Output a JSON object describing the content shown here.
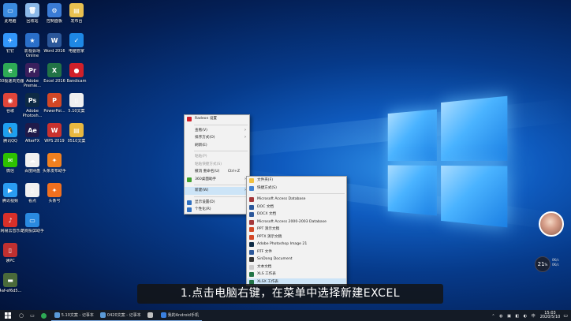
{
  "desktop_icons": [
    {
      "label": "此电脑",
      "color": "#3b8be0",
      "glyph": "▭"
    },
    {
      "label": "回收站",
      "color": "#8bb8e8",
      "glyph": "🗑"
    },
    {
      "label": "控制面板",
      "color": "#3a7bd5",
      "glyph": "⚙"
    },
    {
      "label": "发布台",
      "color": "#e8c050",
      "glyph": "▤"
    },
    {
      "label": "钉钉",
      "color": "#3296fa",
      "glyph": "✈"
    },
    {
      "label": "影视会场\nOnline",
      "color": "#2a6fc9",
      "glyph": "★"
    },
    {
      "label": "Word 2016",
      "color": "#2b579a",
      "glyph": "W"
    },
    {
      "label": "电脑管家",
      "color": "#1e88e5",
      "glyph": "✓"
    },
    {
      "label": "360极速浏览器",
      "color": "#2eaa55",
      "glyph": "e"
    },
    {
      "label": "Adobe\nPremie...",
      "color": "#3a1f5d",
      "glyph": "Pr"
    },
    {
      "label": "Excel 2016",
      "color": "#217346",
      "glyph": "X"
    },
    {
      "label": "Bandicam",
      "color": "#d0202a",
      "glyph": "●"
    },
    {
      "label": "谷歌",
      "color": "#e0453a",
      "glyph": "◉"
    },
    {
      "label": "Adobe\nPhotosh...",
      "color": "#0d2a45",
      "glyph": "Ps"
    },
    {
      "label": "PowerPoi...",
      "color": "#d24726",
      "glyph": "P"
    },
    {
      "label": "5.10文案",
      "color": "#f0f0f0",
      "glyph": "▯"
    },
    {
      "label": "腾讯QQ",
      "color": "#1ea0f0",
      "glyph": "🐧"
    },
    {
      "label": "AfterFX",
      "color": "#1f1a4a",
      "glyph": "Ae"
    },
    {
      "label": "WPS 2019",
      "color": "#c8322f",
      "glyph": "W"
    },
    {
      "label": "0510文案",
      "color": "#e8b840",
      "glyph": "▤"
    },
    {
      "label": "微信",
      "color": "#2dc100",
      "glyph": "✉"
    },
    {
      "label": "百度网盘",
      "color": "#f0f0f0",
      "glyph": "☁"
    },
    {
      "label": "头条发布助手",
      "color": "#f08020",
      "glyph": "✦"
    },
    {
      "label": "腾讯视频",
      "color": "#2a9cf0",
      "glyph": "▶"
    },
    {
      "label": "看点",
      "color": "#f0f0f0",
      "glyph": "▯"
    },
    {
      "label": "头条号",
      "color": "#f07020",
      "glyph": "✦"
    },
    {
      "label": "网易云音乐",
      "color": "#d8302a",
      "glyph": "♪"
    },
    {
      "label": "酷狗投屏助手",
      "color": "#2a8ae0",
      "glyph": "▭"
    },
    {
      "label": "读PC",
      "color": "#c03030",
      "glyph": "▯"
    },
    {
      "label": "4af-ef6d5...",
      "color": "#4a6a3a",
      "glyph": "▬"
    }
  ],
  "context_menu": {
    "items": [
      {
        "label": "Radeon 设置",
        "type": "item",
        "icon": "radeon-icon",
        "iconColor": "#d0202a"
      },
      {
        "type": "sep"
      },
      {
        "label": "查看(V)",
        "type": "item",
        "arrow": true
      },
      {
        "label": "排序方式(O)",
        "type": "item",
        "arrow": true
      },
      {
        "label": "刷新(E)",
        "type": "item"
      },
      {
        "type": "sep"
      },
      {
        "label": "粘贴(P)",
        "type": "item",
        "disabled": true
      },
      {
        "label": "粘贴快捷方式(S)",
        "type": "item",
        "disabled": true
      },
      {
        "label": "撤消 重命名(U)",
        "type": "item",
        "key": "Ctrl+Z"
      },
      {
        "label": "360桌面助手",
        "type": "item",
        "arrow": true,
        "icon": "360-icon",
        "iconColor": "#40a030"
      },
      {
        "type": "sep"
      },
      {
        "label": "新建(W)",
        "type": "item",
        "arrow": true,
        "highlight": true
      },
      {
        "type": "sep"
      },
      {
        "label": "显示设置(D)",
        "type": "item",
        "icon": "display-icon",
        "iconColor": "#3070c0"
      },
      {
        "label": "个性化(R)",
        "type": "item",
        "icon": "personalize-icon",
        "iconColor": "#3070c0"
      }
    ]
  },
  "new_submenu": {
    "items": [
      {
        "label": "文件夹(F)",
        "icon": "folder-icon",
        "iconColor": "#f0c040"
      },
      {
        "label": "快捷方式(S)",
        "icon": "shortcut-icon",
        "iconColor": "#4080d0"
      },
      {
        "type": "sep"
      },
      {
        "label": "Microsoft Access Database",
        "icon": "access-icon",
        "iconColor": "#a4373a"
      },
      {
        "label": "DOC 文档",
        "icon": "doc-icon",
        "iconColor": "#2b579a"
      },
      {
        "label": "DOCX 文档",
        "icon": "docx-icon",
        "iconColor": "#2b579a"
      },
      {
        "label": "Microsoft Access 2000-2003 Database",
        "icon": "access-icon",
        "iconColor": "#a4373a"
      },
      {
        "label": "PPT 演示文稿",
        "icon": "ppt-icon",
        "iconColor": "#d24726"
      },
      {
        "label": "PPTX 演示文稿",
        "icon": "pptx-icon",
        "iconColor": "#d24726"
      },
      {
        "label": "Adobe Photoshop Image 21",
        "icon": "psd-icon",
        "iconColor": "#0d2a45"
      },
      {
        "label": "RTF 文件",
        "icon": "rtf-icon",
        "iconColor": "#2b579a"
      },
      {
        "label": "SinDong Document",
        "icon": "sindong-icon",
        "iconColor": "#333333"
      },
      {
        "label": "文本文档",
        "icon": "txt-icon",
        "iconColor": "#cccccc"
      },
      {
        "label": "XLS 工作表",
        "icon": "xls-icon",
        "iconColor": "#217346"
      },
      {
        "label": "XLSX 工作表",
        "icon": "xlsx-icon",
        "iconColor": "#217346",
        "highlight": true
      }
    ]
  },
  "caption": "1.点击电脑右键，在菜单中选择新建EXCEL",
  "taskbar": {
    "items": [
      {
        "label": "5.10文案 - 记事本",
        "color": "#5a9ad8"
      },
      {
        "label": "0420文案 - 记事本",
        "color": "#5a9ad8"
      },
      {
        "label": "",
        "color": "#c0c0c0"
      },
      {
        "label": "我的Android手机",
        "color": "#3a80e0"
      }
    ],
    "time": "15:03",
    "date": "2020/5/10"
  },
  "widgets": {
    "speed_value": "21",
    "speed_unit": "%",
    "up": "0K/s",
    "down": "0K/s"
  }
}
